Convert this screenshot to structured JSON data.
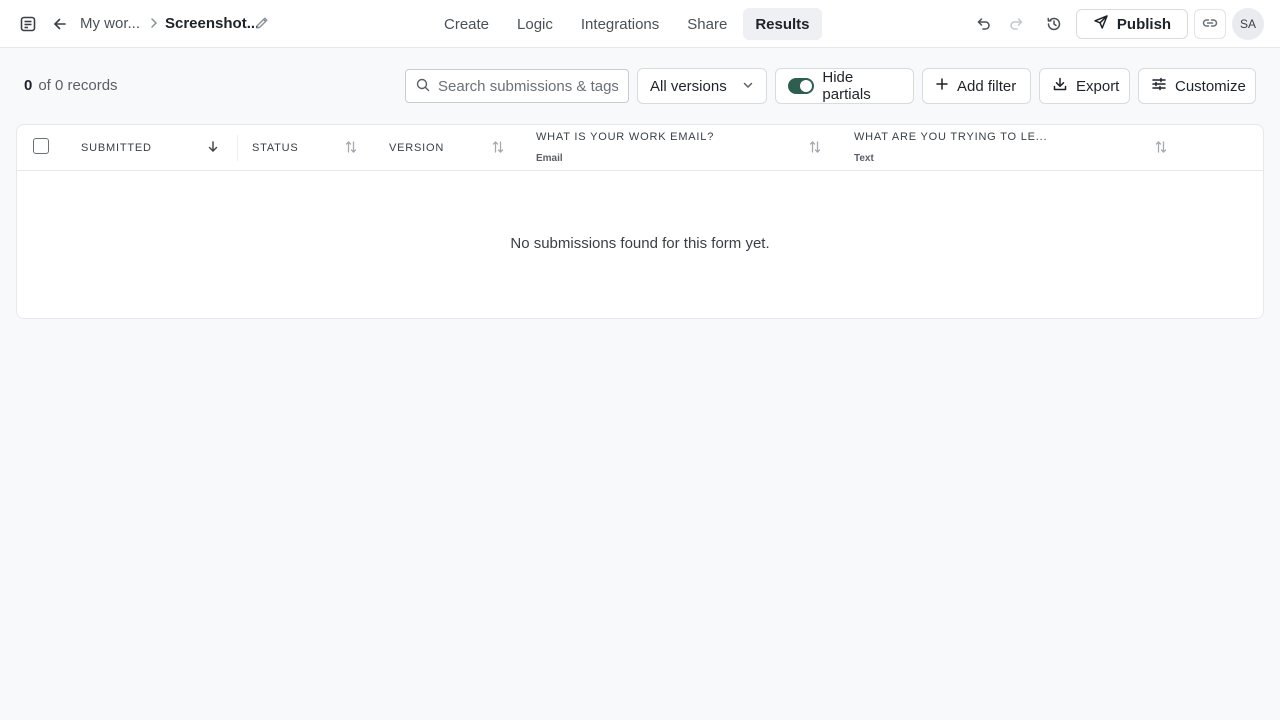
{
  "header": {
    "breadcrumb_parent": "My wor...",
    "breadcrumb_current": "Screenshot...",
    "nav": [
      {
        "label": "Create"
      },
      {
        "label": "Logic"
      },
      {
        "label": "Integrations"
      },
      {
        "label": "Share"
      },
      {
        "label": "Results"
      }
    ],
    "active_tab": "Results",
    "publish_label": "Publish",
    "avatar_initials": "SA"
  },
  "toolbar": {
    "count": "0",
    "count_suffix": "of 0 records",
    "search_placeholder": "Search submissions & tags...",
    "versions_label": "All versions",
    "hide_partials_label": "Hide partials",
    "hide_partials_on": true,
    "add_filter_label": "Add filter",
    "export_label": "Export",
    "customize_label": "Customize"
  },
  "table": {
    "columns": [
      {
        "label": "SUBMITTED",
        "sub": ""
      },
      {
        "label": "STATUS",
        "sub": ""
      },
      {
        "label": "VERSION",
        "sub": ""
      },
      {
        "label": "WHAT IS YOUR WORK EMAIL?",
        "sub": "Email"
      },
      {
        "label": "WHAT ARE YOU TRYING TO LE...",
        "sub": "Text"
      }
    ],
    "empty_message": "No submissions found for this form yet."
  },
  "colors": {
    "toggle_on": "#2f5e50",
    "background": "#f8f9fb"
  }
}
